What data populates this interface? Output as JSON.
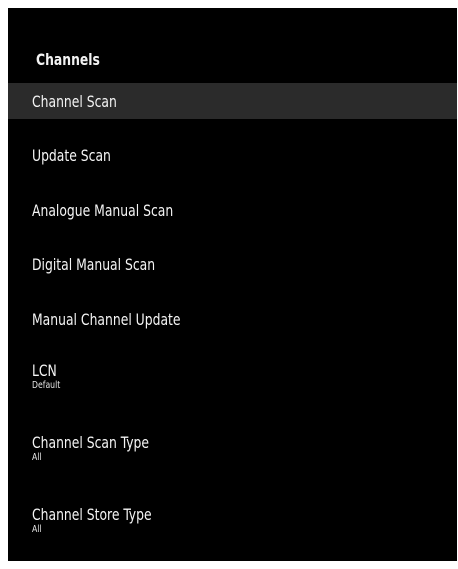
{
  "panel": {
    "title": "Channels"
  },
  "menu": {
    "items": [
      {
        "label": "Channel Scan",
        "focused": true
      },
      {
        "label": "Update Scan"
      },
      {
        "label": "Analogue Manual Scan"
      },
      {
        "label": "Digital Manual Scan"
      },
      {
        "label": "Manual Channel Update"
      },
      {
        "label": "LCN",
        "value": "Default"
      },
      {
        "label": "Channel Scan Type",
        "value": "All"
      },
      {
        "label": "Channel Store Type",
        "value": "All"
      }
    ]
  },
  "colors": {
    "panel_background": "#000000",
    "focused_row": "#2b2b2b",
    "text": "#f5f5f5",
    "page_background": "#ffffff"
  }
}
